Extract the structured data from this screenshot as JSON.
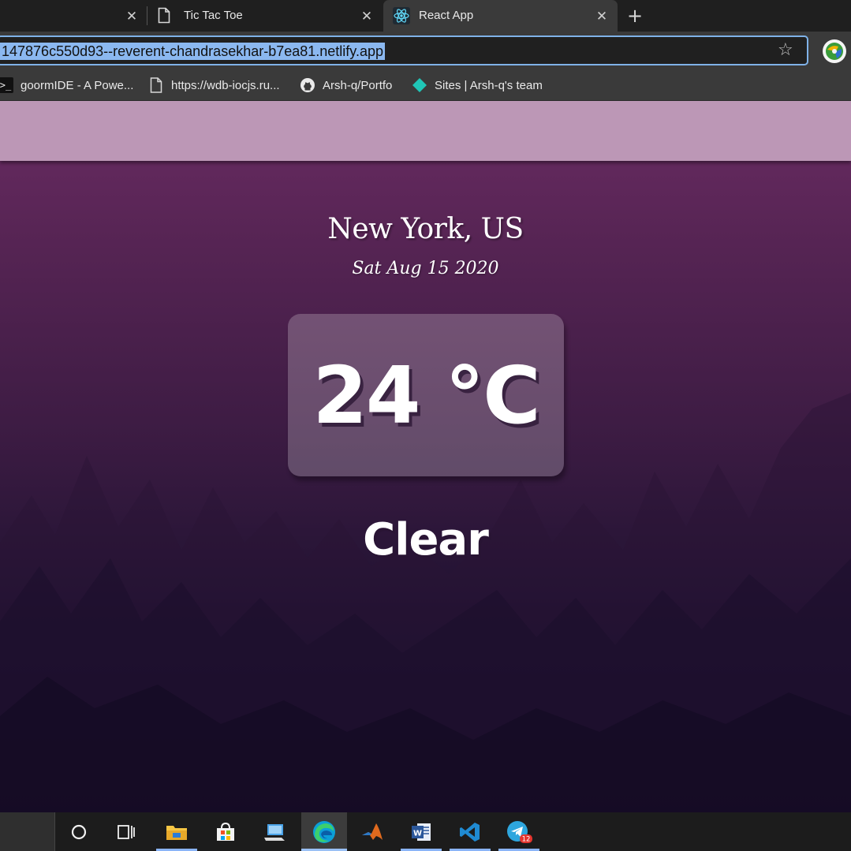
{
  "browser": {
    "tabs": [
      {
        "title": "",
        "close": "✕"
      },
      {
        "title": "Tic Tac Toe",
        "close": "✕"
      },
      {
        "title": "React App",
        "close": "✕",
        "active": true
      }
    ],
    "new_tab": "+",
    "url": "147876c550d93--reverent-chandrasekhar-b7ea81.netlify.app",
    "favorite_star": "☆",
    "bookmarks": [
      {
        "label": "goormIDE - A Powe...",
        "icon": "terminal-icon"
      },
      {
        "label": "https://wdb-iocjs.ru...",
        "icon": "page-icon"
      },
      {
        "label": "Arsh-q/Portfo",
        "icon": "github-icon"
      },
      {
        "label": "Sites | Arsh-q's team",
        "icon": "netlify-icon"
      }
    ]
  },
  "weather": {
    "location": "New York, US",
    "date": "Sat Aug 15 2020",
    "temperature": "24 °C",
    "condition": "Clear"
  },
  "taskbar": {
    "icons": [
      "cortana-icon",
      "task-view-icon",
      "file-explorer-icon",
      "store-icon",
      "pc-icon",
      "edge-icon",
      "matlab-icon",
      "word-icon",
      "vscode-icon",
      "telegram-icon"
    ],
    "telegram_badge": "12"
  },
  "colors": {
    "header_band": "#bc97b6",
    "bg_top": "#6a2b63",
    "bg_bottom": "#120c25",
    "url_highlight": "#8bb8f0",
    "focus_ring": "#7fb2e8"
  }
}
